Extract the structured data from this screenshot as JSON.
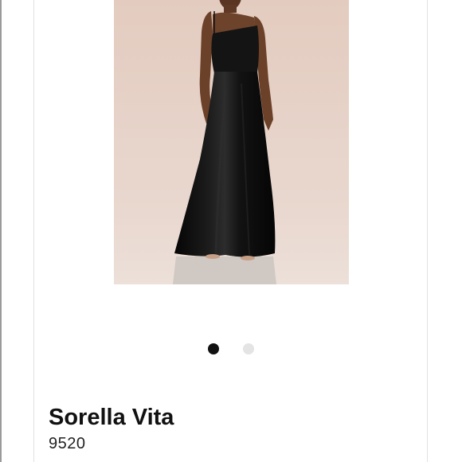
{
  "product": {
    "brand": "Sorella Vita",
    "style_number": "9520",
    "image_alt": "Black satin one-shoulder gown"
  },
  "carousel": {
    "slide_count": 2,
    "active_index": 0,
    "active_color": "#111111",
    "inactive_color": "#e4e4e4"
  },
  "colors": {
    "photo_background": "#e4cfc4",
    "floor": "#eadbd2",
    "dress": "#0e0e0e"
  }
}
